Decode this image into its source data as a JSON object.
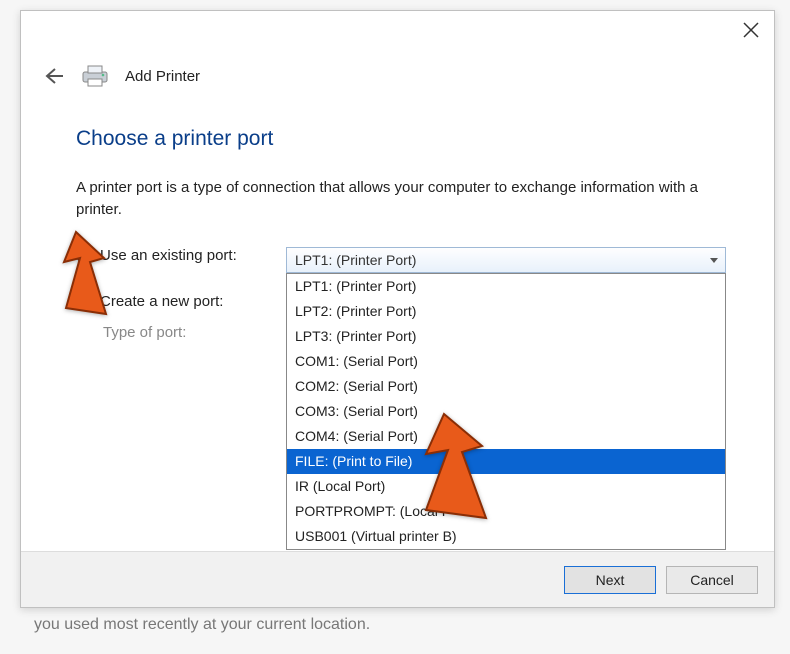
{
  "header": {
    "title": "Add Printer"
  },
  "page": {
    "heading": "Choose a printer port",
    "description": "A printer port is a type of connection that allows your computer to exchange information with a printer."
  },
  "radios": {
    "existing_label": "Use an existing port:",
    "create_label": "Create a new port:",
    "type_label": "Type of port:"
  },
  "combo": {
    "selected": "LPT1: (Printer Port)",
    "options": [
      "LPT1: (Printer Port)",
      "LPT2: (Printer Port)",
      "LPT3: (Printer Port)",
      "COM1: (Serial Port)",
      "COM2: (Serial Port)",
      "COM3: (Serial Port)",
      "COM4: (Serial Port)",
      "FILE: (Print to File)",
      "IR (Local Port)",
      "PORTPROMPT: (Local P",
      "USB001 (Virtual printer                           B)"
    ],
    "highlighted_index": 7
  },
  "footer": {
    "next": "Next",
    "cancel": "Cancel"
  },
  "below_text": "you used most recently at your current location."
}
